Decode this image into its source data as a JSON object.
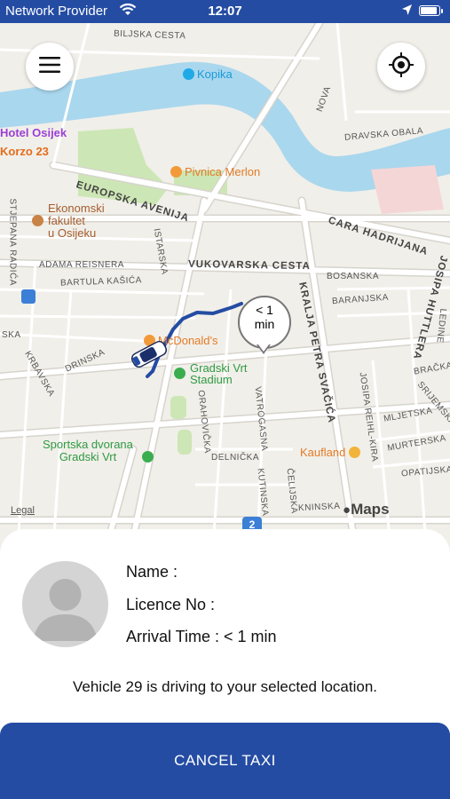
{
  "status_bar": {
    "carrier": "Network Provider",
    "time": "12:07"
  },
  "map": {
    "eta_bubble": {
      "line1": "< 1",
      "line2": "min"
    },
    "legal": "Legal",
    "attribution": "Maps",
    "streets": {
      "biljska": "BILJSKA CESTA",
      "europska": "EUROPSKA AVENIJA",
      "cara_hadrijana": "CARA HADRIJANA",
      "vukovarska": "VUKOVARSKA CESTA",
      "adama": "ADAMA REISNERA",
      "bartula": "BARTULA KAŠIĆA",
      "drinska": "DRINSKA",
      "krbavska": "KRBAVSKA",
      "ska": "SKA",
      "stjepana": "STJEPANA RADIĆA",
      "istarska": "ISTARSKA",
      "bosanska": "BOSANSKA",
      "baranjska": "BARANJSKA",
      "kralja": "KRALJA PETRA SVAČIĆA",
      "josipa_huttlera": "JOSIPA HUTTLERA",
      "ledine": "LEDINE",
      "nova": "NOVA",
      "dravska": "DRAVSKA OBALA",
      "orahovicka": "ORAHOVIČKA",
      "vatrogasna": "VATROGASNA",
      "delnicka": "DELNIČKA",
      "kutinska": "KUTINSKA",
      "celijska": "ČELIJSKA",
      "kninska": "KNINSKA",
      "josipa_reihl": "JOSIPA REIHL-KIRA",
      "bracka": "BRAČKA",
      "srijemska": "SRIJEMSKA",
      "mljetska": "MLJETSKA",
      "murterska": "MURTERSKA",
      "opatijska": "OPATIJSKA"
    },
    "pois": {
      "kopika": "Kopika",
      "hotel_osijek": "Hotel Osijek",
      "korzo": "Korzo 23",
      "pivnica": "Pivnica Merlon",
      "ekonomski": [
        "Ekonomski",
        "fakultet",
        "u Osijeku"
      ],
      "mcdonalds": "McDonald's",
      "gradski_vrt": [
        "Gradski Vrt",
        "Stadium"
      ],
      "sportska": [
        "Sportska dvorana",
        "Gradski Vrt"
      ],
      "kaufland": "Kaufland",
      "route_badge": "2"
    }
  },
  "driver": {
    "name_label": "Name :",
    "licence_label": "Licence No :",
    "arrival_label": "Arrival Time : < 1 min"
  },
  "message": "Vehicle 29 is driving to your selected location.",
  "cancel_label": "CANCEL TAXI",
  "colors": {
    "brand": "#244ca3",
    "water": "#a9d7ee",
    "park": "#bfe1a6"
  },
  "icons": [
    "wifi-icon",
    "location-arrow-icon",
    "battery-icon",
    "menu-icon",
    "crosshair-icon",
    "user-avatar-icon",
    "taxi-car-icon"
  ]
}
